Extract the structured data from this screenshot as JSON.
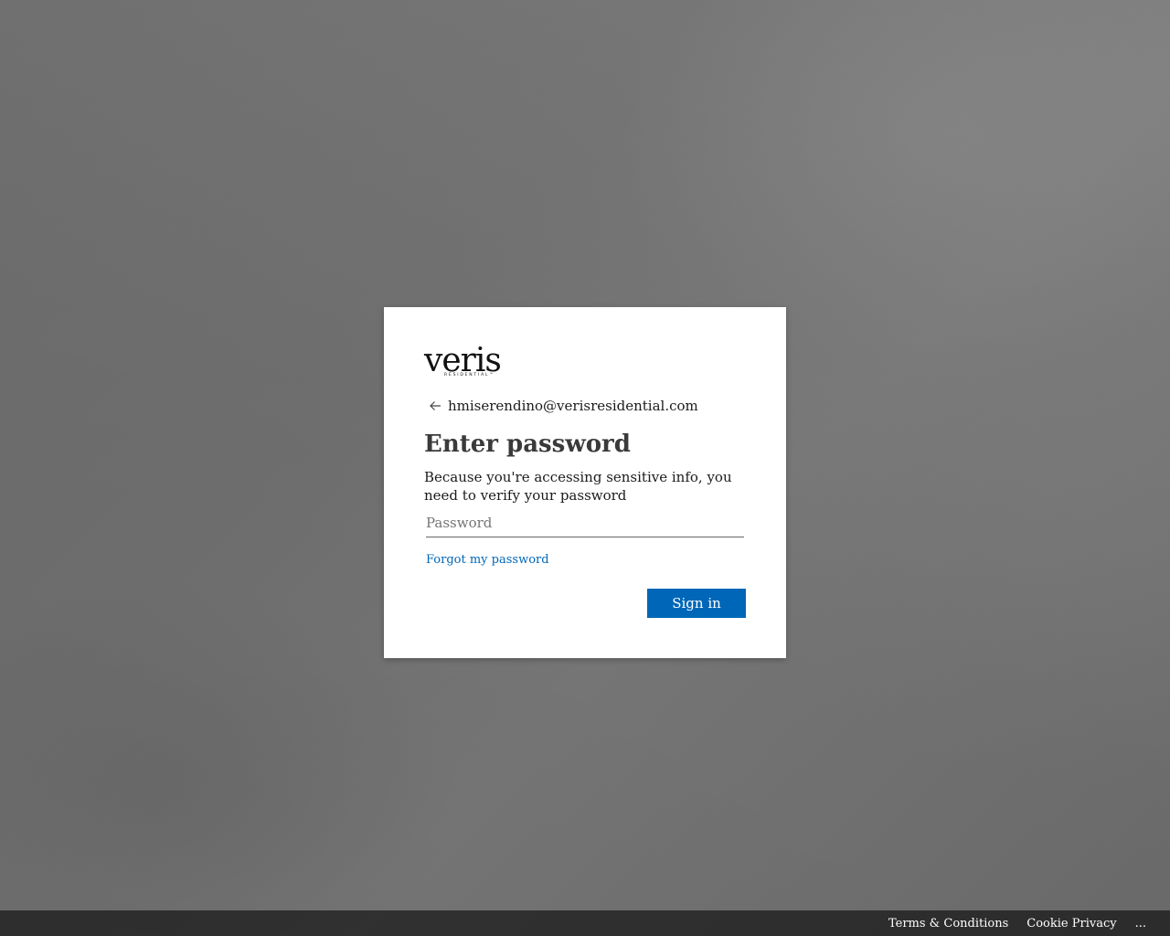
{
  "brand": {
    "logo_text": "veris",
    "logo_subtext": "RESIDENTIAL™"
  },
  "identity": {
    "back_icon": "arrow-left-icon",
    "email": "hmiserendino@verisresidential.com"
  },
  "page": {
    "title": "Enter password",
    "description": "Because you're accessing sensitive info, you need to verify your password"
  },
  "password_field": {
    "placeholder": "Password",
    "value": ""
  },
  "links": {
    "forgot_password": "Forgot my password"
  },
  "buttons": {
    "sign_in": "Sign in"
  },
  "footer": {
    "terms": "Terms & Conditions",
    "cookie": "Cookie Privacy",
    "more": "..."
  },
  "colors": {
    "accent": "#0067b8",
    "card_background": "#ffffff",
    "footer_background": "#000000"
  }
}
